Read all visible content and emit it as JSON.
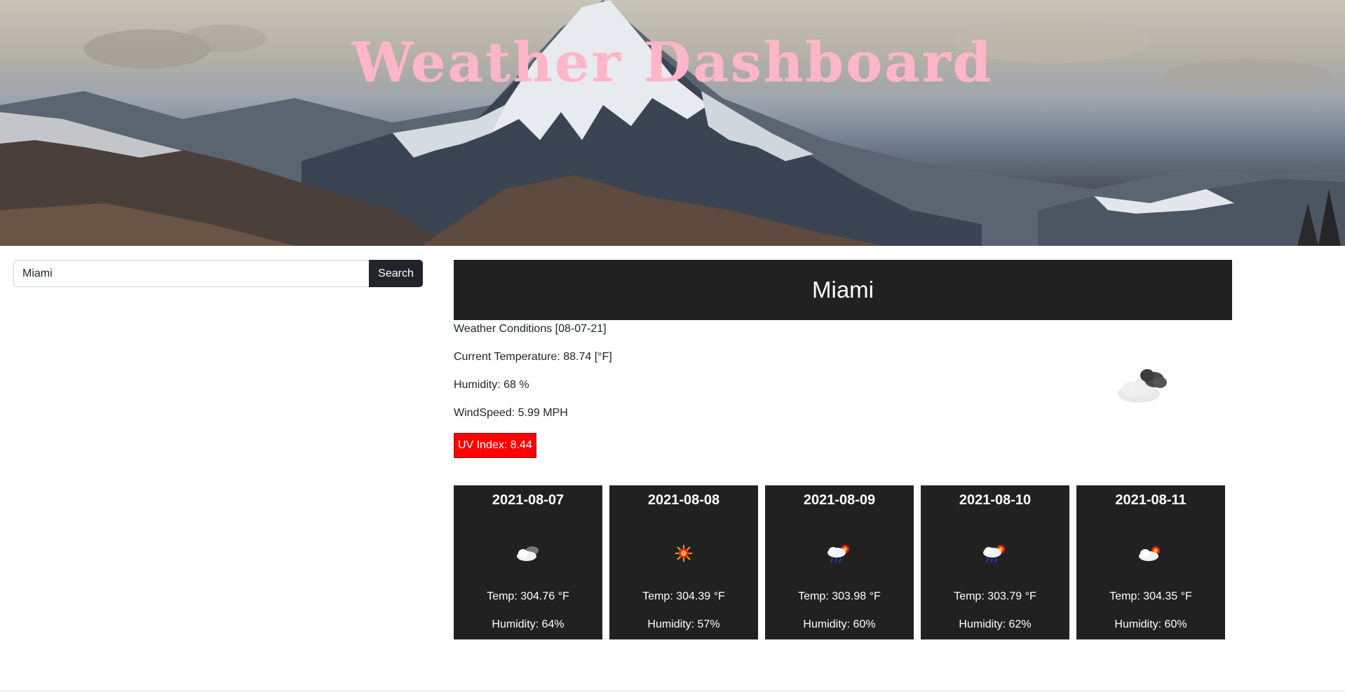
{
  "header": {
    "title": "Weather Dashboard"
  },
  "search": {
    "value": "Miami",
    "button_label": "Search"
  },
  "current": {
    "city": "Miami",
    "conditions_label": "Weather Conditions [08-07-21]",
    "temperature_label": "Current Temperature: 88.74 [°F]",
    "humidity_label": "Humidity: 68 %",
    "wind_label": "WindSpeed: 5.99 MPH",
    "uv_label": "UV Index: 8.44",
    "uv_color": "#ff0000",
    "icon": "dark-clouds-icon"
  },
  "forecast": [
    {
      "date": "2021-08-07",
      "icon": "cloudy-night-icon",
      "temp": "Temp: 304.76 °F",
      "humidity": "Humidity: 64%"
    },
    {
      "date": "2021-08-08",
      "icon": "sun-icon",
      "temp": "Temp: 304.39 °F",
      "humidity": "Humidity: 57%"
    },
    {
      "date": "2021-08-09",
      "icon": "rain-sun-icon",
      "temp": "Temp: 303.98 °F",
      "humidity": "Humidity: 60%"
    },
    {
      "date": "2021-08-10",
      "icon": "rain-sun-icon",
      "temp": "Temp: 303.79 °F",
      "humidity": "Humidity: 62%"
    },
    {
      "date": "2021-08-11",
      "icon": "cloud-sun-icon",
      "temp": "Temp: 304.35 °F",
      "humidity": "Humidity: 60%"
    }
  ],
  "colors": {
    "title_pink": "#ffb6c8",
    "card_bg": "#212121",
    "button_bg": "#212529"
  }
}
